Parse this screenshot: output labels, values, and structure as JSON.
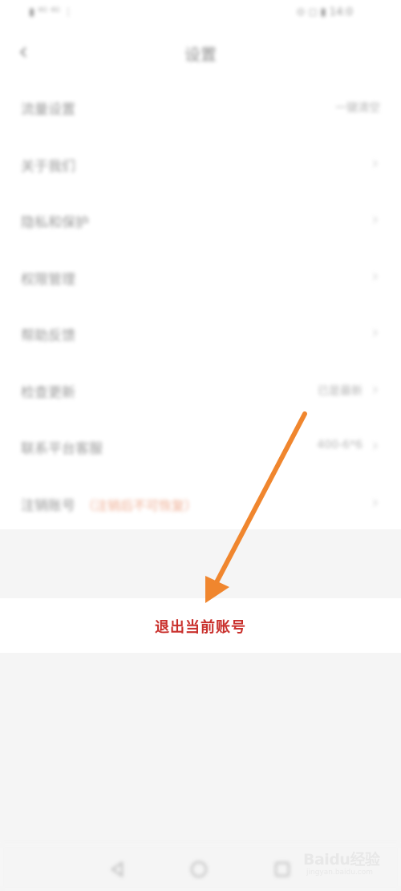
{
  "status_bar": {
    "left": "▮ ⁴ᴳ ⁴ᴳ ⋮",
    "right": "⊙ ◻ ▮ 14:0"
  },
  "nav": {
    "back_icon": "chevron-left-icon",
    "title": "设置"
  },
  "settings": {
    "items": [
      {
        "label": "流量设置",
        "value": "一键清空"
      },
      {
        "label": "关于我们",
        "value": ""
      },
      {
        "label": "隐私和保护",
        "value": ""
      },
      {
        "label": "权限管理",
        "value": ""
      },
      {
        "label": "帮助反馈",
        "value": ""
      },
      {
        "label": "检查更新",
        "value": "已是最新"
      },
      {
        "label": "联系平台客服",
        "value": "400-6*6"
      },
      {
        "label": "注销账号",
        "note": "（注销后不可恢复）",
        "value": ""
      }
    ]
  },
  "logout": {
    "label": "退出当前账号"
  },
  "annotation": {
    "arrow_color": "#f0862e",
    "arrow_icon": "orange-arrow"
  },
  "bottom_nav": {
    "back_icon": "triangle-back-icon",
    "home_icon": "circle-home-icon",
    "recent_icon": "square-recent-icon"
  },
  "watermark": {
    "brand": "Baidu经验",
    "url": "jingyan.baidu.com"
  }
}
